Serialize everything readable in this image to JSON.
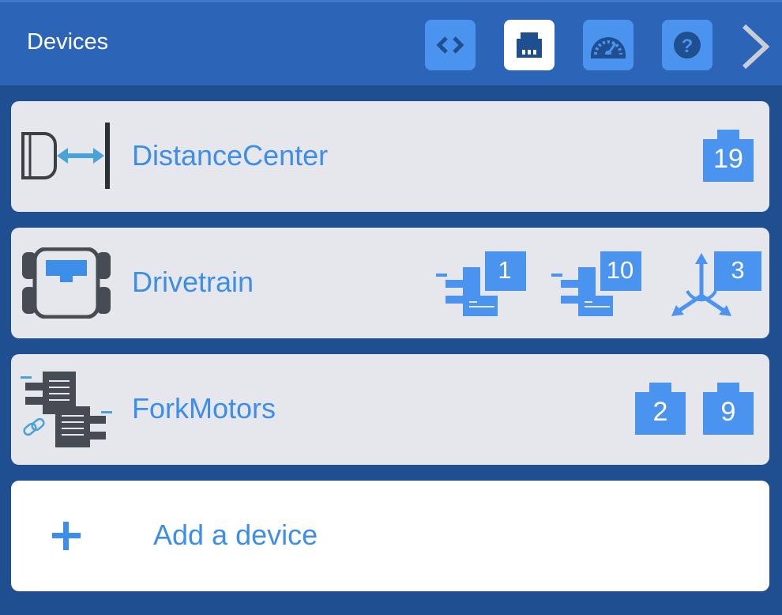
{
  "header": {
    "title": "Devices",
    "toolbar": [
      {
        "name": "code-view-button",
        "icon": "code-brackets-icon"
      },
      {
        "name": "devices-button",
        "icon": "port-plug-icon",
        "active": true
      },
      {
        "name": "dashboard-button",
        "icon": "speedometer-icon"
      },
      {
        "name": "help-button",
        "icon": "question-icon"
      }
    ],
    "next_icon": "chevron-right-icon"
  },
  "devices": [
    {
      "name": "DistanceCenter",
      "icon": "distance-sensor-icon",
      "ports": [
        "19"
      ]
    },
    {
      "name": "Drivetrain",
      "icon": "drivetrain-icon",
      "ports": [
        {
          "kind": "motor",
          "value": "1"
        },
        {
          "kind": "motor",
          "value": "10"
        },
        {
          "kind": "gyro",
          "value": "3"
        }
      ]
    },
    {
      "name": "ForkMotors",
      "icon": "motor-group-icon",
      "ports": [
        "2",
        "9"
      ]
    }
  ],
  "add_device": {
    "label": "Add a device",
    "icon": "plus-icon"
  },
  "colors": {
    "background": "#204f91",
    "header": "#2c65b8",
    "accent": "#4a94f0",
    "text_accent": "#3d8ee8",
    "row": "#e6e7ed"
  }
}
